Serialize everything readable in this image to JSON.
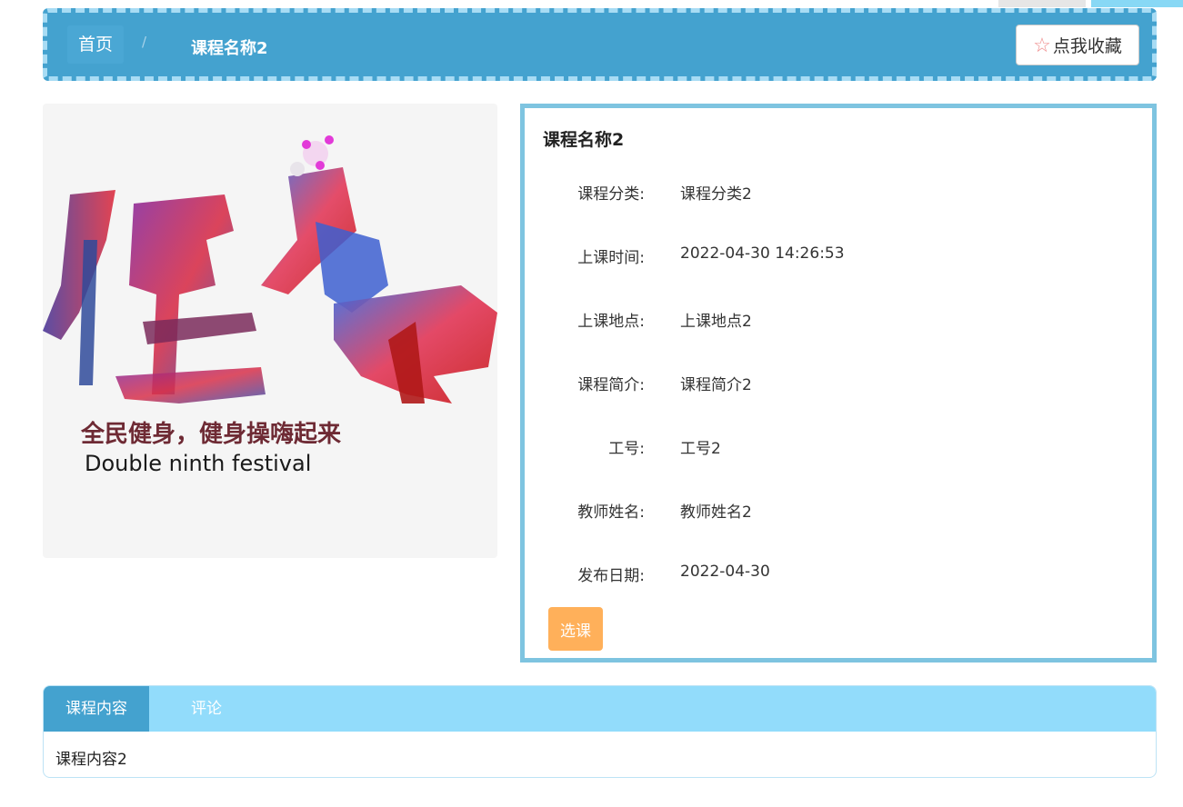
{
  "breadcrumb": {
    "home": "首页",
    "separator": "/",
    "current": "课程名称2"
  },
  "favorite_button": {
    "icon": "star-outline-icon",
    "label": "点我收藏"
  },
  "poster": {
    "brush_text": "健身操",
    "slogan_cn": "全民健身，健身操嗨起来",
    "slogan_en": "Double ninth festival"
  },
  "course": {
    "title": "课程名称2",
    "fields": [
      {
        "label": "课程分类:",
        "value": "课程分类2"
      },
      {
        "label": "上课时间:",
        "value": "2022-04-30 14:26:53"
      },
      {
        "label": "上课地点:",
        "value": "上课地点2"
      },
      {
        "label": "课程简介:",
        "value": "课程简介2"
      },
      {
        "label": "工号:",
        "value": "工号2"
      },
      {
        "label": "教师姓名:",
        "value": "教师姓名2"
      },
      {
        "label": "发布日期:",
        "value": "2022-04-30"
      }
    ],
    "select_label": "选课"
  },
  "tabs": {
    "items": [
      {
        "label": "课程内容",
        "active": true
      },
      {
        "label": "评论",
        "active": false
      }
    ],
    "content": "课程内容2"
  },
  "colors": {
    "header_bg": "#44a2cf",
    "header_border": "#a8dcf4",
    "panel_border": "#7ec4e0",
    "tab_bar": "#92dcfb",
    "select_button": "#ffb05a"
  }
}
